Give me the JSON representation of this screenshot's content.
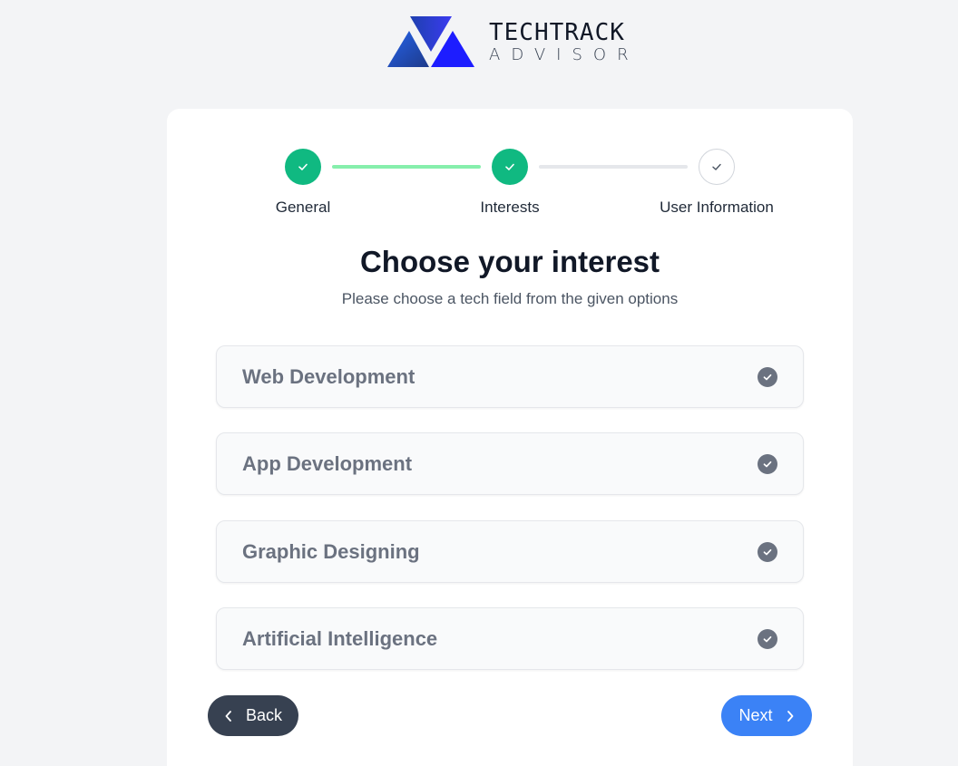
{
  "brand": {
    "title": "TECHTRACK",
    "subtitle": "ADVISOR",
    "logo_icon": "triangles-logo-icon",
    "colors": {
      "dark": "#1e3a8a",
      "blue": "#1d4ed8",
      "bright": "#2563eb"
    }
  },
  "stepper": {
    "steps": [
      {
        "label": "General",
        "state": "done"
      },
      {
        "label": "Interests",
        "state": "done"
      },
      {
        "label": "User Information",
        "state": "pending"
      }
    ],
    "colors": {
      "done": "#10b981",
      "line_done": "#86efac",
      "line_pending": "#e5e7eb"
    }
  },
  "main": {
    "title": "Choose your interest",
    "subtitle": "Please choose a tech field from the given options",
    "options": [
      {
        "label": "Web Development",
        "icon": "check-circle-icon"
      },
      {
        "label": "App Development",
        "icon": "check-circle-icon"
      },
      {
        "label": "Graphic Designing",
        "icon": "check-circle-icon"
      },
      {
        "label": "Artificial Intelligence",
        "icon": "check-circle-icon"
      }
    ]
  },
  "nav": {
    "back_label": "Back",
    "next_label": "Next",
    "colors": {
      "back": "#374151",
      "next": "#3b82f6"
    }
  }
}
